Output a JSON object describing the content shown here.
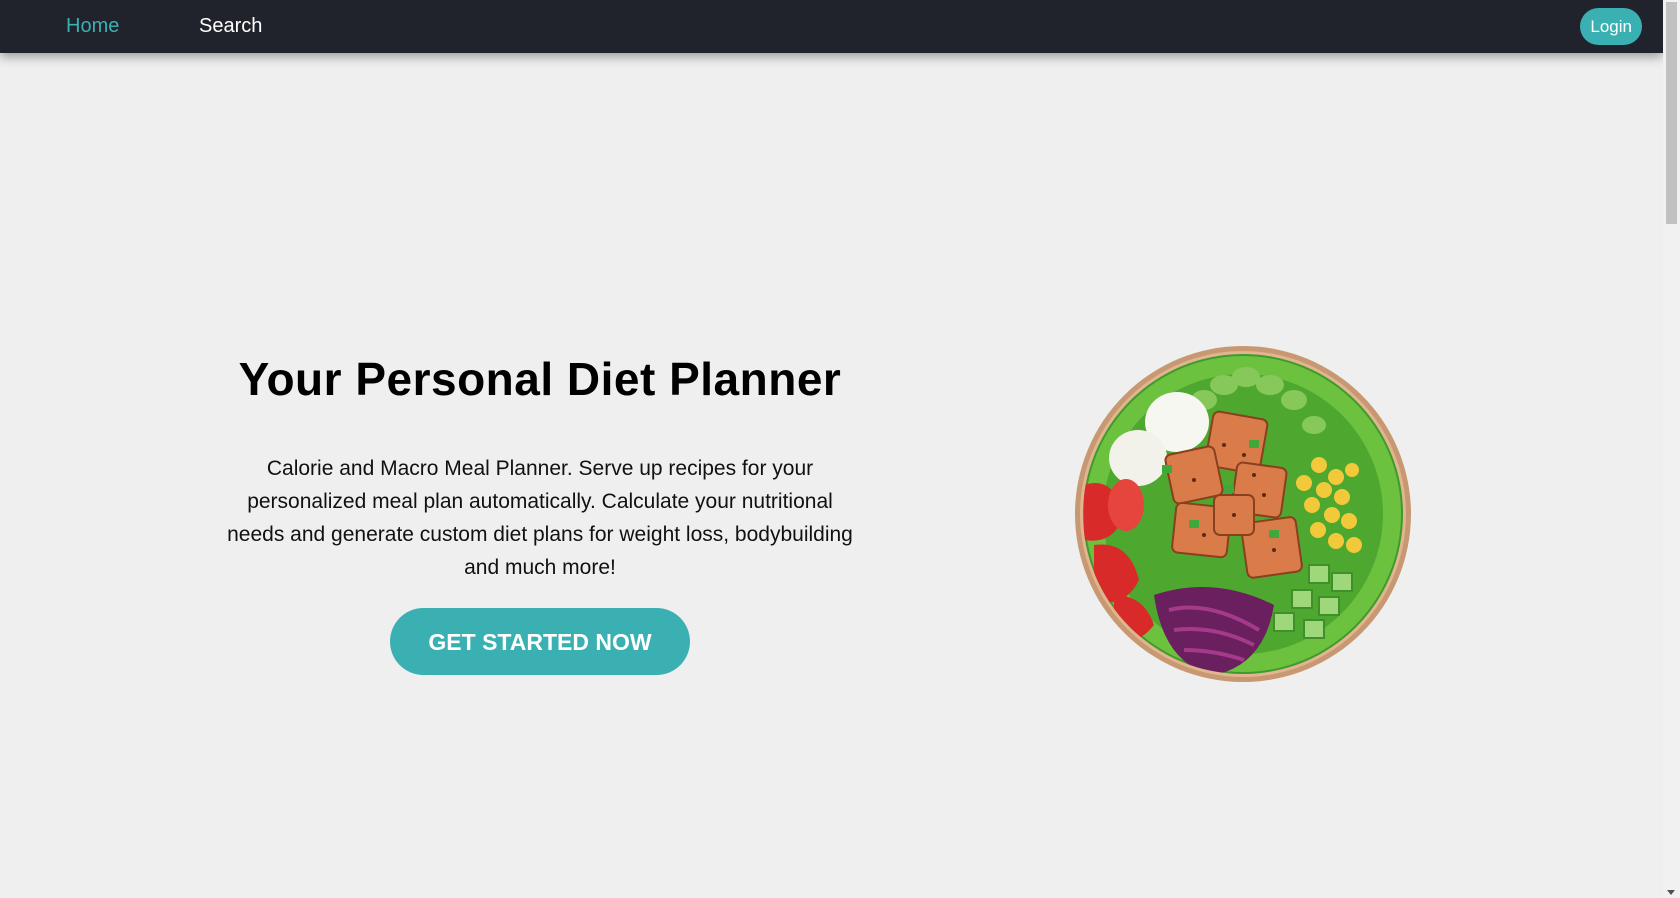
{
  "nav": {
    "home_label": "Home",
    "search_label": "Search",
    "login_label": "Login"
  },
  "hero": {
    "title": "Your Personal Diet Planner",
    "description": "Calorie and Macro Meal Planner. Serve up recipes for your personalized meal plan automatically. Calculate your nutritional needs and generate custom diet plans for weight loss, bodybuilding and much more!",
    "cta_label": "GET STARTED NOW"
  },
  "colors": {
    "accent": "#3bb0b2",
    "navbar_bg": "#20232c",
    "page_bg": "#efefef"
  },
  "icons": {
    "hero_image": "salad-bowl-image"
  }
}
